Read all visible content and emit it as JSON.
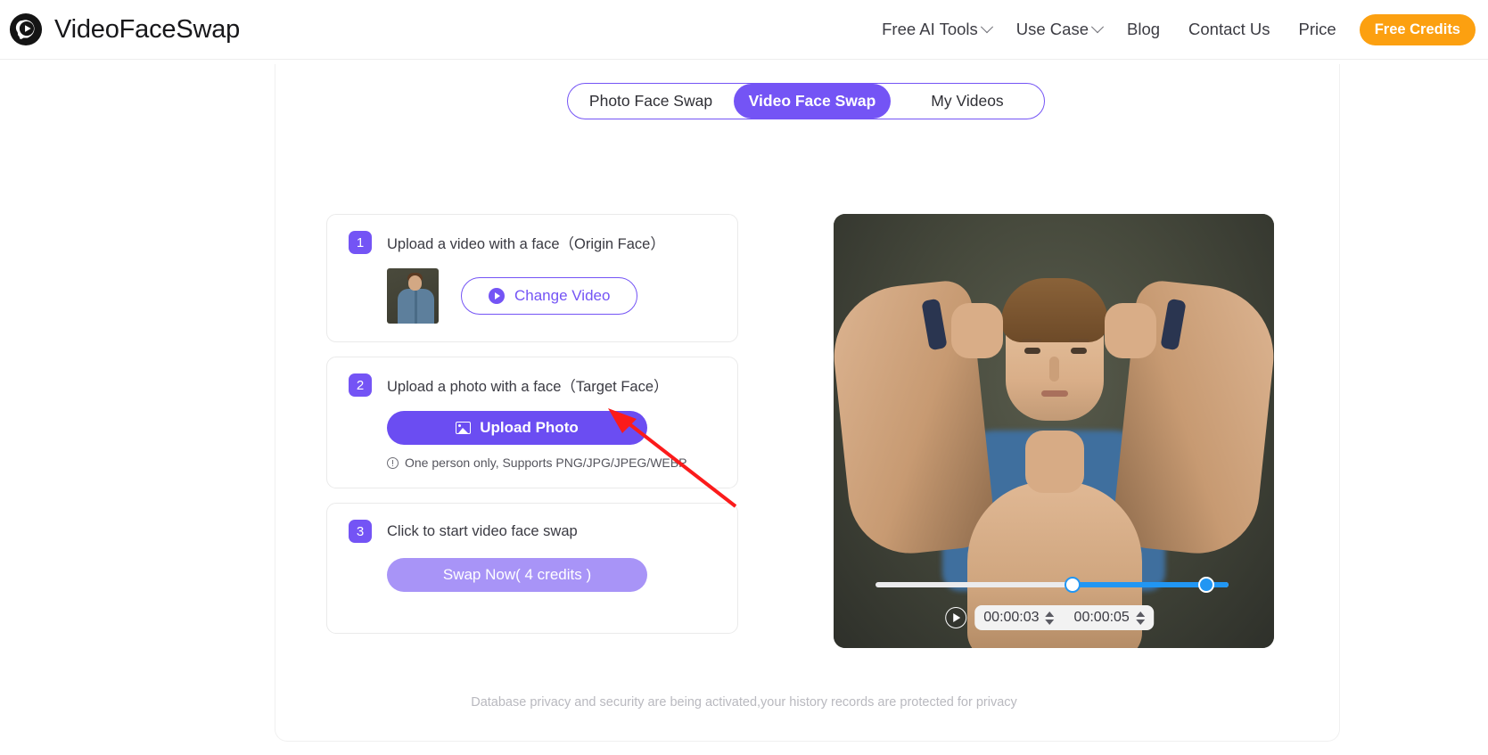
{
  "header": {
    "brand": "VideoFaceSwap",
    "logo_icon": "play-face-logo-icon",
    "nav": [
      {
        "label": "Free AI Tools",
        "has_dropdown": true,
        "icon": "chevron-down-icon"
      },
      {
        "label": "Use Case",
        "has_dropdown": true,
        "icon": "chevron-down-icon"
      },
      {
        "label": "Blog",
        "has_dropdown": false
      },
      {
        "label": "Contact Us",
        "has_dropdown": false
      },
      {
        "label": "Price",
        "has_dropdown": false
      }
    ],
    "cta": {
      "label": "Free Credits",
      "color": "#fca010",
      "text_color": "#ffffff"
    }
  },
  "tabs": {
    "items": [
      {
        "label": "Photo Face Swap",
        "active": false
      },
      {
        "label": "Video Face Swap",
        "active": true
      },
      {
        "label": "My Videos",
        "active": false
      }
    ],
    "accent": "#7454f5"
  },
  "steps": [
    {
      "number": "1",
      "title": "Upload a video with a face（Origin Face）",
      "thumbnail_alt": "man-in-blue-shirt-thumbnail",
      "button": {
        "label": "Change Video",
        "icon": "play-circle-icon",
        "style": "outline"
      }
    },
    {
      "number": "2",
      "title": "Upload a photo with a face（Target Face）",
      "button": {
        "label": "Upload Photo",
        "icon": "image-icon",
        "style": "primary"
      },
      "hint": {
        "icon": "info-circle-icon",
        "text": "One person only, Supports PNG/JPG/JPEG/WEBP"
      }
    },
    {
      "number": "3",
      "title": "Click to start video face swap",
      "button": {
        "label": "Swap Now( 4 credits )",
        "style": "disabled"
      }
    }
  ],
  "video_preview": {
    "alt": "muscular-man-flexing-preview",
    "play_icon": "play-circle-icon",
    "start_time": "00:00:03",
    "end_time": "00:00:05",
    "slider": {
      "fill_color": "#2196f3",
      "track_color": "#ebebed",
      "handle_count": 2
    }
  },
  "footer": {
    "note": "Database privacy and security are being activated,your history records are protected for privacy"
  },
  "annotation": {
    "arrow_color": "#fb1b1b",
    "points_to": "upload-photo-button"
  },
  "colors": {
    "purple": "#7454f5",
    "purple_solid": "#6b4df2",
    "purple_light": "#a894f7",
    "orange": "#fca010",
    "blue": "#2196f3"
  }
}
